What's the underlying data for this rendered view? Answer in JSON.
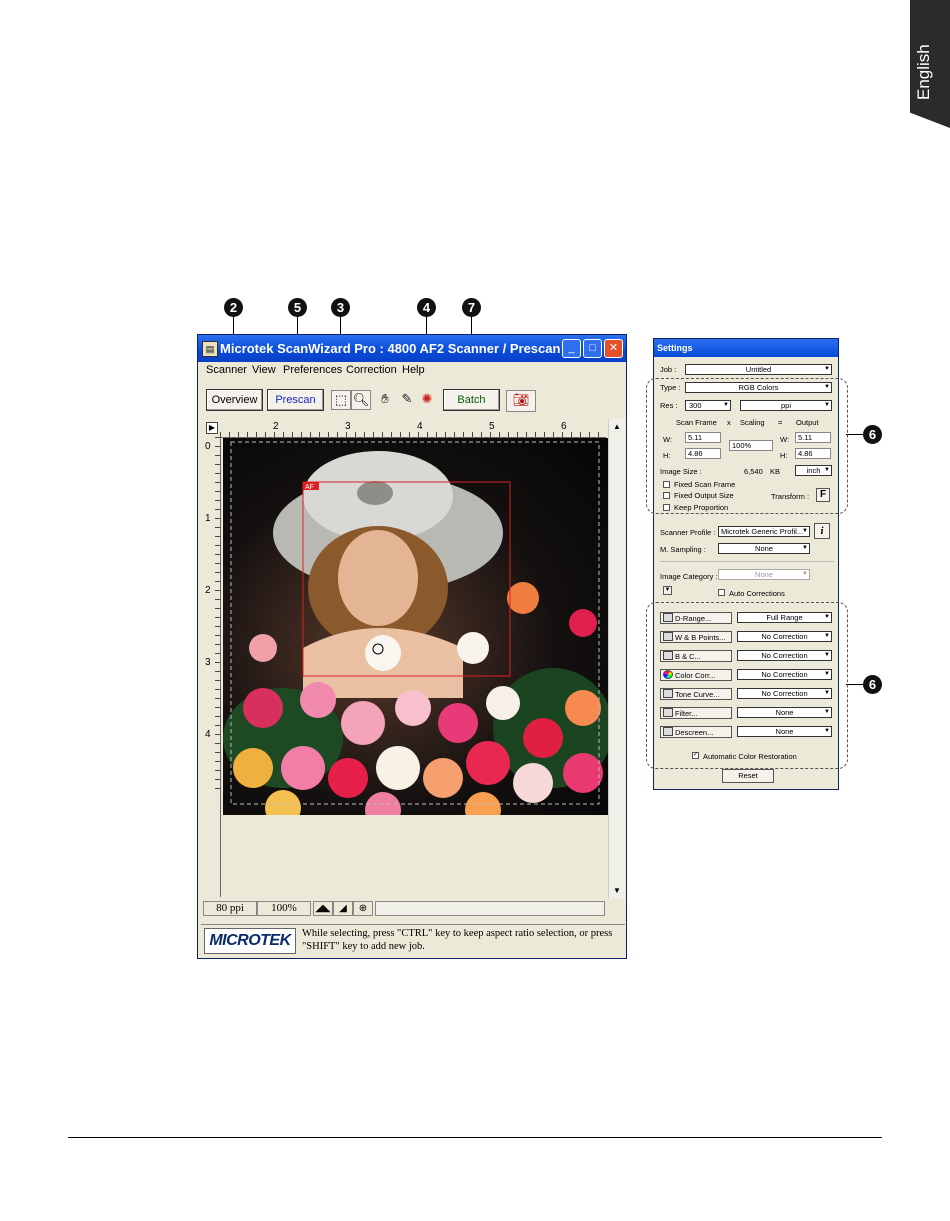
{
  "language_tab": "English",
  "callouts": [
    "2",
    "5",
    "3",
    "4",
    "7",
    "6",
    "6"
  ],
  "window": {
    "title": "Microtek ScanWizard Pro : 4800 AF2 Scanner / Prescan",
    "menu": [
      "Scanner",
      "View",
      "Preferences",
      "Correction",
      "Help"
    ],
    "toolbar": {
      "overview": "Overview",
      "prescan": "Prescan",
      "batch": "Batch",
      "icons": [
        "selection-frame-icon",
        "magnify-icon",
        "hand-icon",
        "eyedropper-icon",
        "auto-focus-icon",
        "camera-icon"
      ]
    },
    "ruler_top": [
      "2",
      "3",
      "4",
      "5",
      "6"
    ],
    "ruler_left": [
      "0",
      "1",
      "2",
      "3",
      "4"
    ],
    "frame_tag": "AF",
    "status": {
      "resolution": "80 ppi",
      "zoom": "100%"
    },
    "logo": "MICROTEK",
    "hint": "While selecting, press \"CTRL\" key to keep aspect ratio selection, or press \"SHIFT\" key to add new job."
  },
  "settings": {
    "title": "Settings",
    "job_label": "Job :",
    "job_value": "Untitled",
    "type_label": "Type :",
    "type_value": "RGB Colors",
    "res_label": "Res :",
    "res_value": "300",
    "res_unit": "ppi",
    "scan_frame": "Scan Frame",
    "x_sign": "x",
    "scaling": "Scaling",
    "eq_sign": "=",
    "output": "Output",
    "w_label": "W:",
    "h_label": "H:",
    "w_in": "5.11",
    "h_in": "4.86",
    "scale_value": "100%",
    "w_out": "5.11",
    "h_out": "4.86",
    "image_size_label": "Image Size :",
    "image_size_value": "6,540",
    "image_size_unit": "KB",
    "unit_value": "inch",
    "fixed_scan_frame": "Fixed Scan Frame",
    "fixed_output_size": "Fixed Output Size",
    "keep_proportion": "Keep Proportion",
    "transform_label": "Transform :",
    "transform_icon": "F",
    "scanner_profile_label": "Scanner Profile :",
    "scanner_profile_value": "Microtek Generic Profil...",
    "info_icon": "i",
    "m_sampling_label": "M. Sampling :",
    "m_sampling_value": "None",
    "image_category_label": "Image Category :",
    "image_category_value": "None",
    "auto_corrections": "Auto Corrections",
    "corrections": [
      {
        "label": "D-Range...",
        "value": "Full Range"
      },
      {
        "label": "W & B Points...",
        "value": "No Correction"
      },
      {
        "label": "B & C...",
        "value": "No Correction"
      },
      {
        "label": "Color Corr...",
        "value": "No Correction"
      },
      {
        "label": "Tone Curve...",
        "value": "No Correction"
      },
      {
        "label": "Filter...",
        "value": "None"
      },
      {
        "label": "Descreen...",
        "value": "None"
      }
    ],
    "auto_color_restoration": "Automatic Color Restoration",
    "reset": "Reset"
  }
}
